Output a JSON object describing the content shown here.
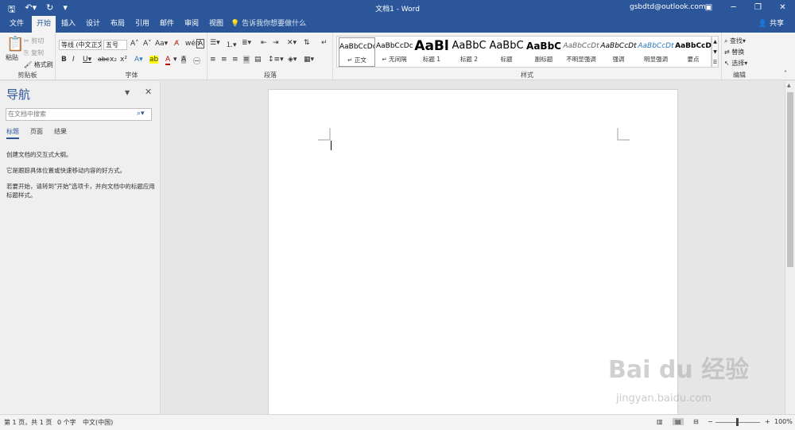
{
  "titlebar": {
    "save_icon": "save-icon",
    "undo_icon": "undo-icon",
    "redo_icon": "redo-icon",
    "customize_icon": "customize-qat-icon",
    "doc_title": "文档1 - Word",
    "account": "gsbdtd@outlook.com",
    "ribbon_display_icon": "ribbon-display-icon",
    "minimize_icon": "minimize-icon",
    "restore_icon": "restore-icon",
    "close_icon": "close-icon"
  },
  "tabs": [
    "文件",
    "开始",
    "插入",
    "设计",
    "布局",
    "引用",
    "邮件",
    "审阅",
    "视图"
  ],
  "active_tab": "开始",
  "tell_me": "告诉我你想要做什么",
  "share": "共享",
  "ribbon": {
    "clipboard": {
      "paste": "粘贴",
      "cut": "剪切",
      "copy": "复制",
      "format_painter": "格式刷",
      "label": "剪贴板"
    },
    "font": {
      "font_name": "等线 (中文正文)",
      "font_size": "五号",
      "label": "字体"
    },
    "paragraph": {
      "label": "段落"
    },
    "styles": {
      "label": "样式",
      "items": [
        {
          "sample": "AaBbCcDc",
          "name": "正文"
        },
        {
          "sample": "AaBbCcDc",
          "name": "无间隔"
        },
        {
          "sample": "AaBl",
          "name": "标题 1"
        },
        {
          "sample": "AaBbC",
          "name": "标题 2"
        },
        {
          "sample": "AaBbC",
          "name": "标题"
        },
        {
          "sample": "AaBbC",
          "name": "副标题"
        },
        {
          "sample": "AaBbCcDt",
          "name": "不明显强调"
        },
        {
          "sample": "AaBbCcDt",
          "name": "强调"
        },
        {
          "sample": "AaBbCcDt",
          "name": "明显强调"
        },
        {
          "sample": "AaBbCcD",
          "name": "要点"
        }
      ]
    },
    "editing": {
      "find": "查找",
      "replace": "替换",
      "select": "选择",
      "label": "编辑"
    }
  },
  "nav": {
    "title": "导航",
    "search_placeholder": "在文档中搜索",
    "tabs": [
      "标题",
      "页面",
      "结果"
    ],
    "line1": "创建文档的交互式大纲。",
    "line2": "它是跟踪具体位置或快速移动内容的好方式。",
    "line3": "若要开始，请转到\"开始\"选项卡，并向文档中的标题应用标题样式。"
  },
  "status": {
    "page": "第 1 页，共 1 页",
    "words": "0 个字",
    "language": "中文(中国)",
    "zoom": "100%"
  },
  "watermark": {
    "text": "Bai du 经验",
    "url": "jingyan.baidu.com"
  },
  "colors": {
    "accent": "#2b579a",
    "ribbon_bg": "#f3f3f3",
    "canvas_bg": "#e6e6e6"
  }
}
